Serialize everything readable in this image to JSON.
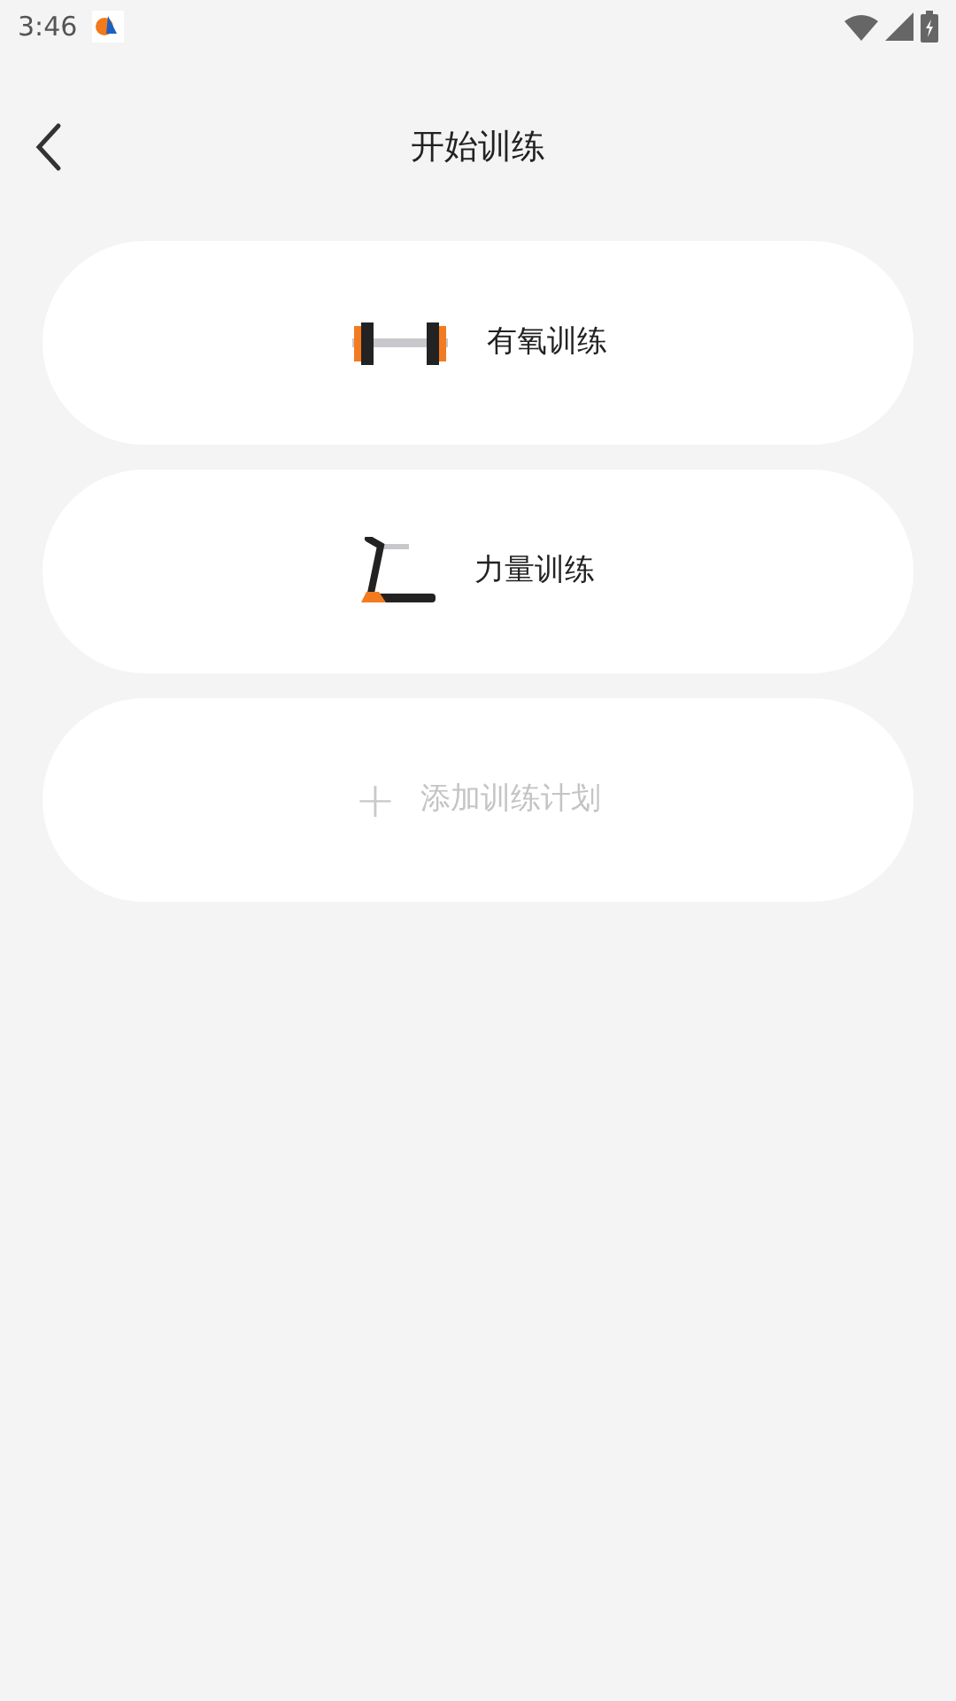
{
  "status_bar": {
    "time": "3:46"
  },
  "header": {
    "title": "开始训练"
  },
  "options": [
    {
      "kind": "dumbbell",
      "label": "有氧训练"
    },
    {
      "kind": "treadmill",
      "label": "力量训练"
    },
    {
      "kind": "add",
      "label": "添加训练计划",
      "icon": "+"
    }
  ]
}
